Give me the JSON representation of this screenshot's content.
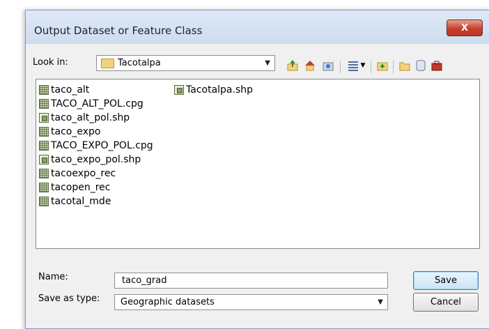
{
  "window": {
    "title": "Output Dataset or Feature Class",
    "close_glyph": "X"
  },
  "lookin": {
    "label": "Look in:",
    "value": "Tacotalpa",
    "folder_icon": "folder-icon"
  },
  "toolbar": {
    "icons": [
      "up-folder-icon",
      "home-icon",
      "connect-folder-icon",
      "view-list-icon",
      "new-folder-icon",
      "folder-icon",
      "database-icon",
      "toolbox-icon"
    ]
  },
  "files": [
    {
      "name": "taco_alt",
      "type": "raster"
    },
    {
      "name": "TACO_ALT_POL.cpg",
      "type": "raster"
    },
    {
      "name": "taco_alt_pol.shp",
      "type": "shape"
    },
    {
      "name": "taco_expo",
      "type": "raster"
    },
    {
      "name": "TACO_EXPO_POL.cpg",
      "type": "raster"
    },
    {
      "name": "taco_expo_pol.shp",
      "type": "shape"
    },
    {
      "name": "tacoexpo_rec",
      "type": "raster"
    },
    {
      "name": "tacopen_rec",
      "type": "raster"
    },
    {
      "name": "tacotal_mde",
      "type": "raster"
    },
    {
      "name": "Tacotalpa.shp",
      "type": "shape"
    }
  ],
  "name_field": {
    "label": "Name:",
    "value": "taco_grad"
  },
  "type_field": {
    "label": "Save as type:",
    "value": "Geographic datasets"
  },
  "buttons": {
    "save": "Save",
    "cancel": "Cancel"
  },
  "colors": {
    "title_bar": "#d6e3f3",
    "close_button": "#c5412b",
    "folder": "#f3d37a"
  }
}
